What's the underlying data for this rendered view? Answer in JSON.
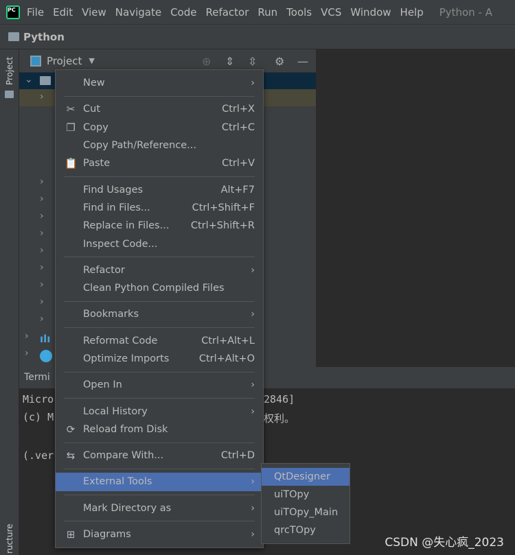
{
  "menubar": {
    "items": [
      "File",
      "Edit",
      "View",
      "Navigate",
      "Code",
      "Refactor",
      "Run",
      "Tools",
      "VCS",
      "Window",
      "Help"
    ],
    "window_title": "Python - A"
  },
  "navbar": {
    "project": "Python"
  },
  "left_strip": {
    "project_tab": "Project",
    "structure_tab": "ructure"
  },
  "project_panel": {
    "title": "Project"
  },
  "terminal": {
    "tab": "Termi",
    "lines": [
      "Micro",
      "(c) M",
      "",
      "(.ver"
    ],
    "right_lines": [
      "2846]",
      "权利。"
    ]
  },
  "context_menu": {
    "groups": [
      [
        {
          "label": "New",
          "submenu": true
        }
      ],
      [
        {
          "label": "Cut",
          "shortcut": "Ctrl+X",
          "icon": "scissors-icon"
        },
        {
          "label": "Copy",
          "shortcut": "Ctrl+C",
          "icon": "copy-icon"
        },
        {
          "label": "Copy Path/Reference..."
        },
        {
          "label": "Paste",
          "shortcut": "Ctrl+V",
          "icon": "paste-icon"
        }
      ],
      [
        {
          "label": "Find Usages",
          "shortcut": "Alt+F7"
        },
        {
          "label": "Find in Files...",
          "shortcut": "Ctrl+Shift+F"
        },
        {
          "label": "Replace in Files...",
          "shortcut": "Ctrl+Shift+R"
        },
        {
          "label": "Inspect Code..."
        }
      ],
      [
        {
          "label": "Refactor",
          "submenu": true
        },
        {
          "label": "Clean Python Compiled Files"
        }
      ],
      [
        {
          "label": "Bookmarks",
          "submenu": true
        }
      ],
      [
        {
          "label": "Reformat Code",
          "shortcut": "Ctrl+Alt+L"
        },
        {
          "label": "Optimize Imports",
          "shortcut": "Ctrl+Alt+O"
        }
      ],
      [
        {
          "label": "Open In",
          "submenu": true
        }
      ],
      [
        {
          "label": "Local History",
          "submenu": true
        },
        {
          "label": "Reload from Disk",
          "icon": "reload-icon"
        }
      ],
      [
        {
          "label": "Compare With...",
          "shortcut": "Ctrl+D",
          "icon": "compare-icon"
        }
      ],
      [
        {
          "label": "External Tools",
          "submenu": true,
          "highlighted": true
        }
      ],
      [
        {
          "label": "Mark Directory as",
          "submenu": true
        }
      ],
      [
        {
          "label": "Diagrams",
          "submenu": true,
          "icon": "diagram-icon"
        }
      ]
    ]
  },
  "external_tools_submenu": {
    "items": [
      "QtDesigner",
      "uiTOpy",
      "uiTOpy_Main",
      "qrcTOpy"
    ],
    "highlighted": "QtDesigner"
  },
  "watermark": "CSDN @失心疯_2023",
  "colors": {
    "highlight": "#4b6eaf",
    "panel": "#3c3f41",
    "editor": "#2b2b2b"
  }
}
